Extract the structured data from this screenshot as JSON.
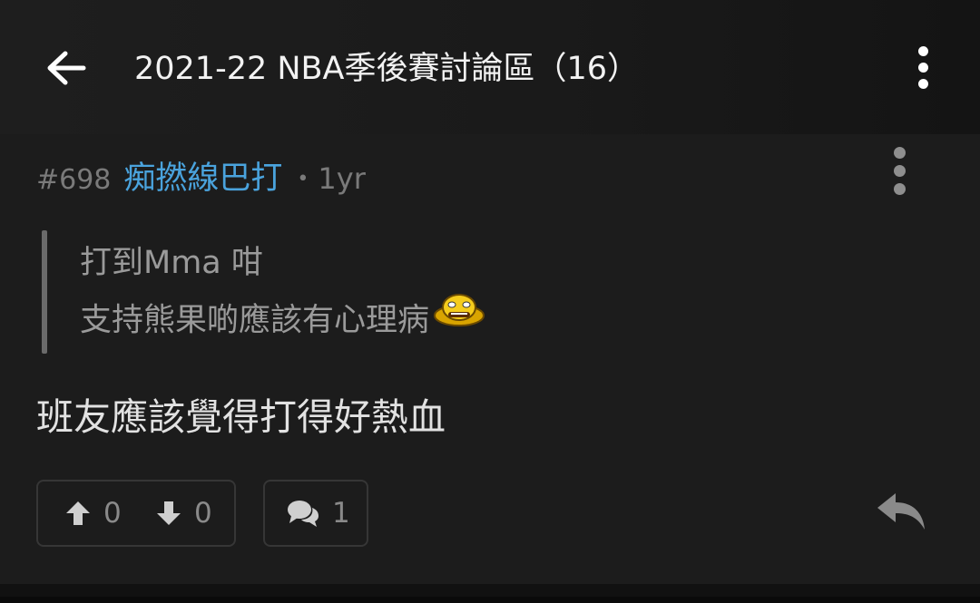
{
  "appbar": {
    "title": "2021-22 NBA季後賽討論區（16）",
    "back_icon": "arrow-left-icon",
    "menu_icon": "more-vertical-icon"
  },
  "post": {
    "number": "#698",
    "author": "痴撚線巴打",
    "separator": "•",
    "time": "1yr",
    "menu_icon": "more-vertical-icon",
    "quote": {
      "line1": "打到Mma 咁",
      "line2": "支持熊果啲應該有心理病",
      "emoji_icon": "smiley-emoji-icon"
    },
    "body": "班友應該覺得打得好熱血",
    "actions": {
      "upvote_count": "0",
      "downvote_count": "0",
      "comment_count": "1",
      "upvote_icon": "arrow-up-icon",
      "downvote_icon": "arrow-down-icon",
      "comment_icon": "comments-icon",
      "reply_icon": "reply-icon"
    }
  },
  "colors": {
    "background": "#1c1c1c",
    "author": "#4aa3dd",
    "muted": "#7a7a7a",
    "quote_text": "#9a9a9a",
    "body_text": "#e2e2e2"
  }
}
